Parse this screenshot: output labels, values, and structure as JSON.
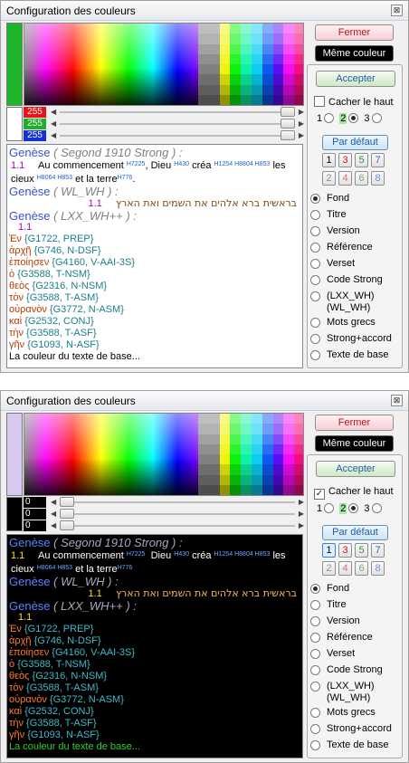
{
  "window_title": "Configuration des couleurs",
  "close_glyph": "⊠",
  "buttons": {
    "fermer": "Fermer",
    "meme_couleur": "Même couleur",
    "accepter": "Accepter",
    "par_defaut": "Par défaut"
  },
  "cacher_le_haut": "Cacher le haut",
  "radio_numbers": [
    "1",
    "2",
    "3"
  ],
  "color_slots": [
    "1",
    "3",
    "5",
    "7",
    "2",
    "4",
    "6",
    "8"
  ],
  "options": [
    "Fond",
    "Titre",
    "Version",
    "Référence",
    "Verset",
    "Code Strong",
    "(LXX_WH)",
    "(WL_WH)",
    "Mots grecs",
    "Strong+accord",
    "Texte de base"
  ],
  "windows": [
    {
      "rgb": [
        "255",
        "255",
        "255"
      ],
      "swatch_color": "#1fb52b",
      "rgb_swatch_color": "#ffffff",
      "cacher_checked": false,
      "selected_radio": 2,
      "preview_background": "#ffffff",
      "colors": {
        "book": "#3a52c7",
        "version": "#808080",
        "ref": "#b000b0",
        "verse": "#000000",
        "strong": "#1e5fd6",
        "hebrew": "#7a4a14",
        "greek": "#b83c00",
        "strong_accord": "#1a7f8a",
        "base": "#000000"
      }
    },
    {
      "rgb": [
        "0",
        "0",
        "0"
      ],
      "swatch_color": "#d8c8f0",
      "rgb_swatch_color": "#000000",
      "cacher_checked": true,
      "selected_radio": 2,
      "preview_background": "#000000",
      "colors": {
        "book": "#5a82ff",
        "version": "#a8a8c0",
        "ref": "#ffe000",
        "verse": "#ffffff",
        "strong": "#6aa8ff",
        "hebrew": "#ffb84d",
        "greek": "#ff7a2e",
        "strong_accord": "#40b8c8",
        "base": "#33cc33"
      }
    }
  ],
  "preview": {
    "v1_book": "Genèse",
    "v1_version": "( Segond 1910 Strong ) :",
    "v1_ref": "1.1",
    "v1_words": [
      "Au commencement",
      "Dieu",
      "créa",
      "les cieux",
      "et la terre"
    ],
    "v1_strongs": [
      "H7225",
      "H430",
      "H1254 H8804 H853",
      "H8064 H853",
      "H776"
    ],
    "v2_book": "Genèse",
    "v2_version": "( WL_WH ) :",
    "v2_ref": "1.1",
    "v2_hebrew": "בראשית ברא אלהים את השמים ואת הארץ",
    "v3_book": "Genèse",
    "v3_version": "( LXX_WH++ ) :",
    "v3_ref": "1.1",
    "greek_lines": [
      {
        "word": "Ἐν",
        "code": "{G1722, PREP}"
      },
      {
        "word": "ἀρχῇ",
        "code": "{G746, N-DSF}"
      },
      {
        "word": "ἐποίησεν",
        "code": "{G4160, V-AAI-3S}"
      },
      {
        "word": "ὁ",
        "code": "{G3588, T-NSM}"
      },
      {
        "word": "θεὸς",
        "code": "{G2316, N-NSM}"
      },
      {
        "word": "τὸν",
        "code": "{G3588, T-ASM}"
      },
      {
        "word": "οὐρανὸν",
        "code": "{G3772, N-ASM}"
      },
      {
        "word": "καὶ",
        "code": "{G2532, CONJ}"
      },
      {
        "word": "τὴν",
        "code": "{G3588, T-ASF}"
      },
      {
        "word": "γῆν",
        "code": "{G1093, N-ASF}"
      }
    ],
    "base_text": "La couleur du texte de base..."
  }
}
